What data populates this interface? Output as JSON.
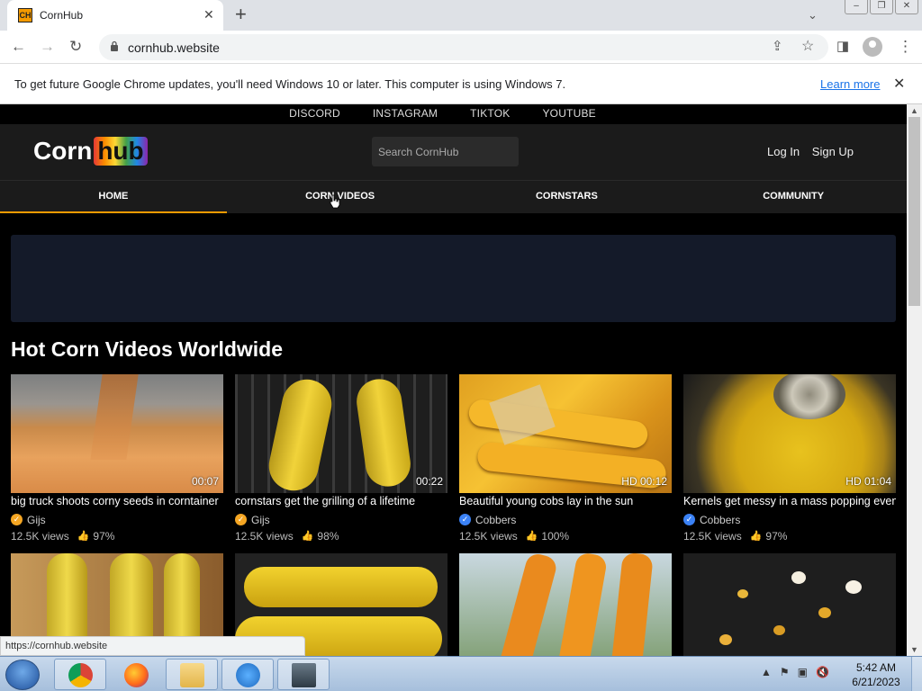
{
  "browser": {
    "tab_title": "CornHub",
    "favicon_text": "CH",
    "url": "cornhub.website",
    "infobar_text": "To get future Google Chrome updates, you'll need Windows 10 or later. This computer is using Windows 7.",
    "infobar_link": "Learn more",
    "status_url": "https://cornhub.website"
  },
  "site": {
    "social": [
      "DISCORD",
      "INSTAGRAM",
      "TIKTOK",
      "YOUTUBE"
    ],
    "logo_left": "Corn",
    "logo_right": "hub",
    "search_placeholder": "Search CornHub",
    "login": "Log In",
    "signup": "Sign Up",
    "nav": [
      "HOME",
      "CORN VIDEOS",
      "CORNSTARS",
      "COMMUNITY"
    ],
    "active_nav": "HOME",
    "section_title": "Hot Corn Videos Worldwide",
    "accent_color": "#f59a00"
  },
  "videos": [
    {
      "title": "big truck shoots corny seeds in corntainer",
      "duration": "00:07",
      "uploader": "Gijs",
      "badge_color": "#f5a623",
      "views": "12.5K views",
      "rating": "97%"
    },
    {
      "title": "cornstars get the grilling of a lifetime",
      "duration": "00:22",
      "uploader": "Gijs",
      "badge_color": "#f5a623",
      "views": "12.5K views",
      "rating": "98%"
    },
    {
      "title": "Beautiful young cobs lay in the sun",
      "duration": "HD 00:12",
      "uploader": "Cobbers",
      "badge_color": "#3b82f6",
      "views": "12.5K views",
      "rating": "100%"
    },
    {
      "title": "Kernels get messy in a mass popping event",
      "duration": "HD 01:04",
      "uploader": "Cobbers",
      "badge_color": "#3b82f6",
      "views": "12.5K views",
      "rating": "97%"
    }
  ],
  "taskbar": {
    "time": "5:42 AM",
    "date": "6/21/2023"
  }
}
